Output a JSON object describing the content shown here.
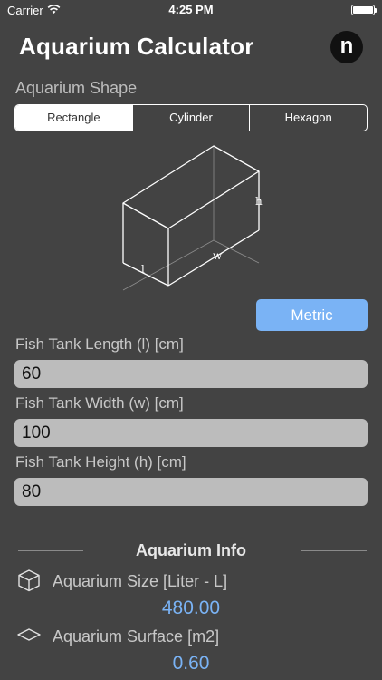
{
  "status_bar": {
    "carrier": "Carrier",
    "time": "4:25 PM"
  },
  "header": {
    "title": "Aquarium Calculator",
    "logo_letter": "n"
  },
  "shape": {
    "label": "Aquarium Shape",
    "options": [
      "Rectangle",
      "Cylinder",
      "Hexagon"
    ],
    "selected": "Rectangle"
  },
  "diagram": {
    "length_label": "l",
    "width_label": "w",
    "height_label": "h"
  },
  "unit_button": {
    "label": "Metric"
  },
  "fields": {
    "length": {
      "label": "Fish Tank Length (l) [cm]",
      "value": "60"
    },
    "width": {
      "label": "Fish Tank Width (w) [cm]",
      "value": "100"
    },
    "height": {
      "label": "Fish Tank Height (h) [cm]",
      "value": "80"
    }
  },
  "info": {
    "title": "Aquarium Info",
    "size_label": "Aquarium Size [Liter - L]",
    "size_value": "480.00",
    "surface_label": "Aquarium Surface [m2]",
    "surface_value": "0.60"
  },
  "colors": {
    "background": "#434343",
    "accent": "#7ab3f5",
    "input": "#bcbcbc"
  }
}
